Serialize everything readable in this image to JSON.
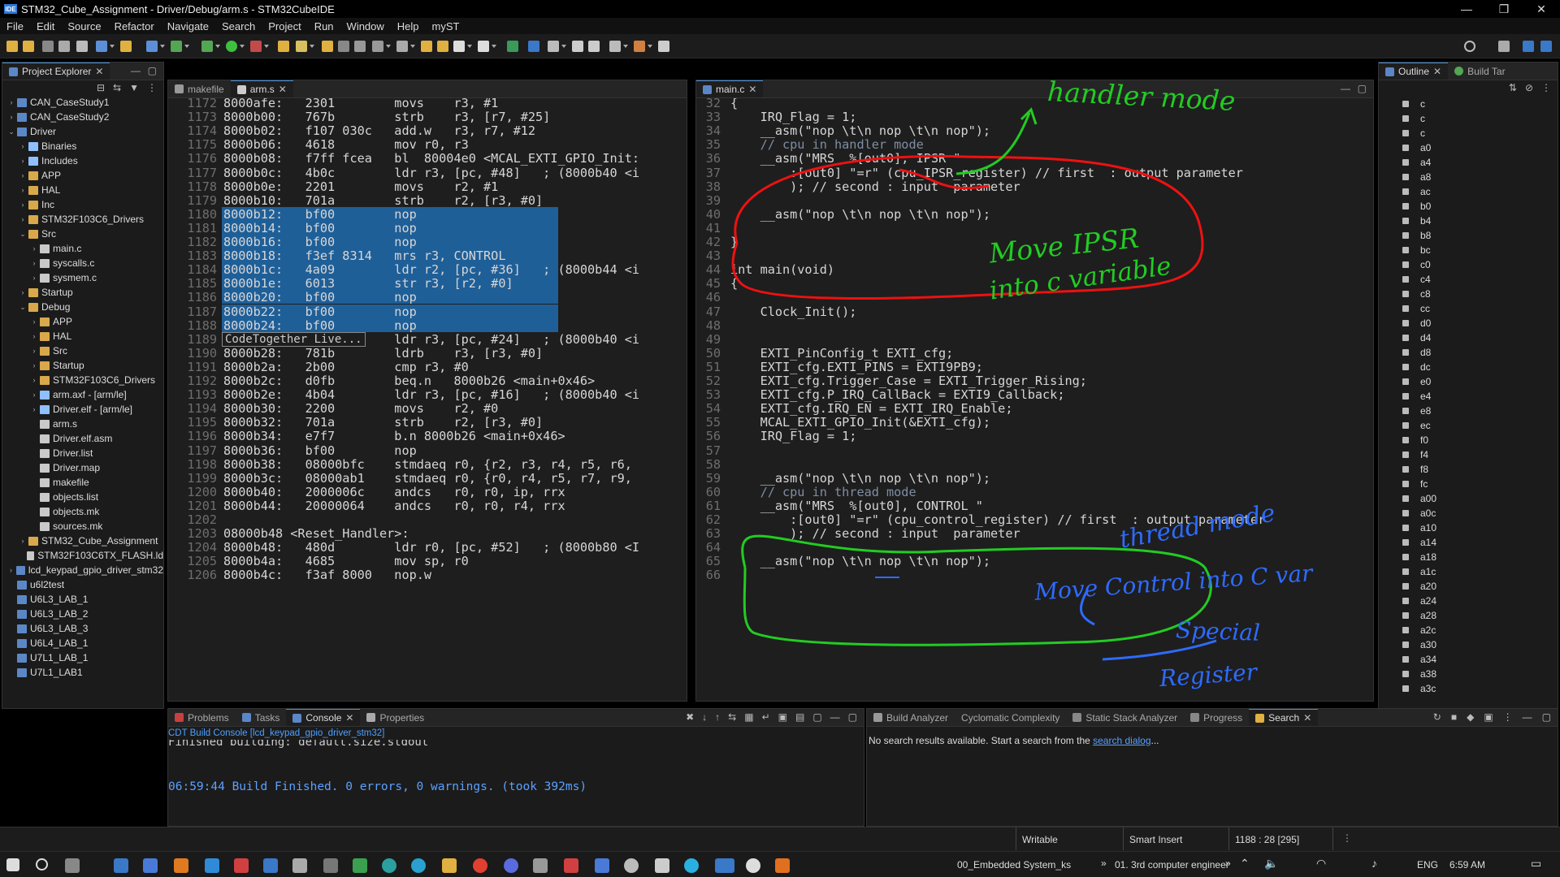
{
  "window": {
    "title": "STM32_Cube_Assignment - Driver/Debug/arm.s - STM32CubeIDE",
    "app_badge": "IDE",
    "controls": [
      "—",
      "❐",
      "✕"
    ]
  },
  "menu": [
    "File",
    "Edit",
    "Source",
    "Refactor",
    "Navigate",
    "Search",
    "Project",
    "Run",
    "Window",
    "Help",
    "myST"
  ],
  "explorer": {
    "title": "Project Explorer",
    "items": [
      {
        "label": "CAN_CaseStudy1",
        "indent": 0,
        "arrow": "›",
        "icon": "proj"
      },
      {
        "label": "CAN_CaseStudy2",
        "indent": 0,
        "arrow": "›",
        "icon": "proj"
      },
      {
        "label": "Driver",
        "indent": 0,
        "arrow": "⌄",
        "icon": "proj"
      },
      {
        "label": "Binaries",
        "indent": 1,
        "arrow": "›",
        "icon": "bin"
      },
      {
        "label": "Includes",
        "indent": 1,
        "arrow": "›",
        "icon": "bin"
      },
      {
        "label": "APP",
        "indent": 1,
        "arrow": "›",
        "icon": "folder"
      },
      {
        "label": "HAL",
        "indent": 1,
        "arrow": "›",
        "icon": "folder"
      },
      {
        "label": "Inc",
        "indent": 1,
        "arrow": "›",
        "icon": "folder"
      },
      {
        "label": "STM32F103C6_Drivers",
        "indent": 1,
        "arrow": "›",
        "icon": "folder"
      },
      {
        "label": "Src",
        "indent": 1,
        "arrow": "⌄",
        "icon": "folder"
      },
      {
        "label": "main.c",
        "indent": 2,
        "arrow": "›",
        "icon": "file"
      },
      {
        "label": "syscalls.c",
        "indent": 2,
        "arrow": "›",
        "icon": "file"
      },
      {
        "label": "sysmem.c",
        "indent": 2,
        "arrow": "›",
        "icon": "file"
      },
      {
        "label": "Startup",
        "indent": 1,
        "arrow": "›",
        "icon": "folder"
      },
      {
        "label": "Debug",
        "indent": 1,
        "arrow": "⌄",
        "icon": "folder"
      },
      {
        "label": "APP",
        "indent": 2,
        "arrow": "›",
        "icon": "folder"
      },
      {
        "label": "HAL",
        "indent": 2,
        "arrow": "›",
        "icon": "folder"
      },
      {
        "label": "Src",
        "indent": 2,
        "arrow": "›",
        "icon": "folder"
      },
      {
        "label": "Startup",
        "indent": 2,
        "arrow": "›",
        "icon": "folder"
      },
      {
        "label": "STM32F103C6_Drivers",
        "indent": 2,
        "arrow": "›",
        "icon": "folder"
      },
      {
        "label": "arm.axf - [arm/le]",
        "indent": 2,
        "arrow": "›",
        "icon": "bin"
      },
      {
        "label": "Driver.elf - [arm/le]",
        "indent": 2,
        "arrow": "›",
        "icon": "bin"
      },
      {
        "label": "arm.s",
        "indent": 2,
        "arrow": "",
        "icon": "file"
      },
      {
        "label": "Driver.elf.asm",
        "indent": 2,
        "arrow": "",
        "icon": "file"
      },
      {
        "label": "Driver.list",
        "indent": 2,
        "arrow": "",
        "icon": "file"
      },
      {
        "label": "Driver.map",
        "indent": 2,
        "arrow": "",
        "icon": "file"
      },
      {
        "label": "makefile",
        "indent": 2,
        "arrow": "",
        "icon": "file"
      },
      {
        "label": "objects.list",
        "indent": 2,
        "arrow": "",
        "icon": "file"
      },
      {
        "label": "objects.mk",
        "indent": 2,
        "arrow": "",
        "icon": "file"
      },
      {
        "label": "sources.mk",
        "indent": 2,
        "arrow": "",
        "icon": "file"
      },
      {
        "label": "STM32_Cube_Assignment",
        "indent": 1,
        "arrow": "›",
        "icon": "folder"
      },
      {
        "label": "STM32F103C6TX_FLASH.ld",
        "indent": 1,
        "arrow": "",
        "icon": "file"
      },
      {
        "label": "lcd_keypad_gpio_driver_stm32",
        "indent": 0,
        "arrow": "›",
        "icon": "proj"
      },
      {
        "label": "u6l2test",
        "indent": 0,
        "arrow": "",
        "icon": "proj"
      },
      {
        "label": "U6L3_LAB_1",
        "indent": 0,
        "arrow": "",
        "icon": "proj"
      },
      {
        "label": "U6L3_LAB_2",
        "indent": 0,
        "arrow": "",
        "icon": "proj"
      },
      {
        "label": "U6L3_LAB_3",
        "indent": 0,
        "arrow": "",
        "icon": "proj"
      },
      {
        "label": "U6L4_LAB_1",
        "indent": 0,
        "arrow": "",
        "icon": "proj"
      },
      {
        "label": "U7L1_LAB_1",
        "indent": 0,
        "arrow": "",
        "icon": "proj"
      },
      {
        "label": "U7L1_LAB1",
        "indent": 0,
        "arrow": "",
        "icon": "proj"
      }
    ]
  },
  "editor_left": {
    "tabs": [
      "makefile",
      "arm.s"
    ],
    "lines": [
      {
        "n": "1172",
        "t": "8000afe:   2301        movs    r3, #1"
      },
      {
        "n": "1173",
        "t": "8000b00:   767b        strb    r3, [r7, #25]"
      },
      {
        "n": "1174",
        "t": "8000b02:   f107 030c   add.w   r3, r7, #12"
      },
      {
        "n": "1175",
        "t": "8000b06:   4618        mov r0, r3"
      },
      {
        "n": "1176",
        "t": "8000b08:   f7ff fcea   bl  80004e0 <MCAL_EXTI_GPIO_Init:"
      },
      {
        "n": "1177",
        "t": "8000b0c:   4b0c        ldr r3, [pc, #48]   ; (8000b40 <i"
      },
      {
        "n": "1178",
        "t": "8000b0e:   2201        movs    r2, #1"
      },
      {
        "n": "1179",
        "t": "8000b10:   701a        strb    r2, [r3, #0]"
      },
      {
        "n": "1180",
        "t": "8000b12:   bf00        nop"
      },
      {
        "n": "1181",
        "t": "8000b14:   bf00        nop"
      },
      {
        "n": "1182",
        "t": "8000b16:   bf00        nop"
      },
      {
        "n": "1183",
        "t": "8000b18:   f3ef 8314   mrs r3, CONTROL"
      },
      {
        "n": "1184",
        "t": "8000b1c:   4a09        ldr r2, [pc, #36]   ; (8000b44 <i"
      },
      {
        "n": "1185",
        "t": "8000b1e:   6013        str r3, [r2, #0]"
      },
      {
        "n": "1186",
        "t": "8000b20:   bf00        nop"
      },
      {
        "n": "1187",
        "t": "8000b22:   bf00        nop"
      },
      {
        "n": "1188",
        "t": "8000b24:   bf00        nop"
      },
      {
        "n": "1189",
        "t": "                       ldr r3, [pc, #24]   ; (8000b40 <i"
      },
      {
        "n": "1190",
        "t": "8000b28:   781b        ldrb    r3, [r3, #0]"
      },
      {
        "n": "1191",
        "t": "8000b2a:   2b00        cmp r3, #0"
      },
      {
        "n": "1192",
        "t": "8000b2c:   d0fb        beq.n   8000b26 <main+0x46>"
      },
      {
        "n": "1193",
        "t": "8000b2e:   4b04        ldr r3, [pc, #16]   ; (8000b40 <i"
      },
      {
        "n": "1194",
        "t": "8000b30:   2200        movs    r2, #0"
      },
      {
        "n": "1195",
        "t": "8000b32:   701a        strb    r2, [r3, #0]"
      },
      {
        "n": "1196",
        "t": "8000b34:   e7f7        b.n 8000b26 <main+0x46>"
      },
      {
        "n": "1197",
        "t": "8000b36:   bf00        nop"
      },
      {
        "n": "1198",
        "t": "8000b38:   08000bfc    stmdaeq r0, {r2, r3, r4, r5, r6,"
      },
      {
        "n": "1199",
        "t": "8000b3c:   08000ab1    stmdaeq r0, {r0, r4, r5, r7, r9,"
      },
      {
        "n": "1200",
        "t": "8000b40:   2000006c    andcs   r0, r0, ip, rrx"
      },
      {
        "n": "1201",
        "t": "8000b44:   20000064    andcs   r0, r0, r4, rrx"
      },
      {
        "n": "1202",
        "t": ""
      },
      {
        "n": "1203",
        "t": "08000b48 <Reset_Handler>:"
      },
      {
        "n": "1204",
        "t": "8000b48:   480d        ldr r0, [pc, #52]   ; (8000b80 <I"
      },
      {
        "n": "1205",
        "t": "8000b4a:   4685        mov sp, r0"
      },
      {
        "n": "1206",
        "t": "8000b4c:   f3af 8000   nop.w"
      }
    ],
    "tooltip": "CodeTogether Live..."
  },
  "editor_right": {
    "tabs": [
      "main.c"
    ],
    "lines": [
      {
        "n": "32",
        "t": "{"
      },
      {
        "n": "33",
        "t": "    IRQ_Flag = 1;"
      },
      {
        "n": "34",
        "t": "    __asm(\"nop \\t\\n nop \\t\\n nop\");"
      },
      {
        "n": "35",
        "t": "    // cpu in handler mode"
      },
      {
        "n": "36",
        "t": "    __asm(\"MRS  %[out0], IPSR \""
      },
      {
        "n": "37",
        "t": "        :[out0] \"=r\" (cpu_IPSR_register) // first  : output parameter"
      },
      {
        "n": "38",
        "t": "        ); // second : input  parameter"
      },
      {
        "n": "39",
        "t": ""
      },
      {
        "n": "40",
        "t": "    __asm(\"nop \\t\\n nop \\t\\n nop\");"
      },
      {
        "n": "41",
        "t": ""
      },
      {
        "n": "42",
        "t": "}"
      },
      {
        "n": "43",
        "t": ""
      },
      {
        "n": "44",
        "t": "int main(void)"
      },
      {
        "n": "45",
        "t": "{"
      },
      {
        "n": "46",
        "t": ""
      },
      {
        "n": "47",
        "t": "    Clock_Init();"
      },
      {
        "n": "48",
        "t": ""
      },
      {
        "n": "49",
        "t": ""
      },
      {
        "n": "50",
        "t": "    EXTI_PinConfig_t EXTI_cfg;"
      },
      {
        "n": "51",
        "t": "    EXTI_cfg.EXTI_PINS = EXTI9PB9;"
      },
      {
        "n": "52",
        "t": "    EXTI_cfg.Trigger_Case = EXTI_Trigger_Rising;"
      },
      {
        "n": "53",
        "t": "    EXTI_cfg.P_IRQ_CallBack = EXTI9_Callback;"
      },
      {
        "n": "54",
        "t": "    EXTI_cfg.IRQ_EN = EXTI_IRQ_Enable;"
      },
      {
        "n": "55",
        "t": "    MCAL_EXTI_GPIO_Init(&EXTI_cfg);"
      },
      {
        "n": "56",
        "t": "    IRQ_Flag = 1;"
      },
      {
        "n": "57",
        "t": ""
      },
      {
        "n": "58",
        "t": ""
      },
      {
        "n": "59",
        "t": "    __asm(\"nop \\t\\n nop \\t\\n nop\");"
      },
      {
        "n": "60",
        "t": "    // cpu in thread mode"
      },
      {
        "n": "61",
        "t": "    __asm(\"MRS  %[out0], CONTROL \""
      },
      {
        "n": "62",
        "t": "        :[out0] \"=r\" (cpu_control_register) // first  : output parameter"
      },
      {
        "n": "63",
        "t": "        ); // second : input  parameter"
      },
      {
        "n": "64",
        "t": ""
      },
      {
        "n": "65",
        "t": "    __asm(\"nop \\t\\n nop \\t\\n nop\");"
      },
      {
        "n": "66",
        "t": ""
      }
    ],
    "annotations": {
      "handler": "handler mode",
      "ipsr1": "Move IPSR",
      "ipsr2": "into c variable",
      "thread": "thread mode",
      "ctrl1": "Move Control into C var",
      "ctrl2": "Special",
      "ctrl3": "Register"
    }
  },
  "outline": {
    "tabs": [
      "Outline",
      "Build Tar"
    ],
    "items": [
      "c",
      "c",
      "c",
      "a0",
      "a4",
      "a8",
      "ac",
      "b0",
      "b4",
      "b8",
      "bc",
      "c0",
      "c4",
      "c8",
      "cc",
      "d0",
      "d4",
      "d8",
      "dc",
      "e0",
      "e4",
      "e8",
      "ec",
      "f0",
      "f4",
      "f8",
      "fc",
      "a00",
      "a0c",
      "a10",
      "a14",
      "a18",
      "a1c",
      "a20",
      "a24",
      "a28",
      "a2c",
      "a30",
      "a34",
      "a38",
      "a3c"
    ]
  },
  "console": {
    "tabs": [
      "Problems",
      "Tasks",
      "Console",
      "Properties"
    ],
    "header": "CDT Build Console [lcd_keypad_gpio_driver_stm32]",
    "line_cut": "Finished building: default.size.stdout",
    "line": "06:59:44 Build Finished. 0 errors, 0 warnings. (took 392ms)"
  },
  "search_panel": {
    "tabs": [
      "Build Analyzer",
      "Cyclomatic Complexity",
      "Static Stack Analyzer",
      "Progress",
      "Search"
    ],
    "message": "No search results available. Start a search from the ",
    "link": "search dialog",
    "ellipsis": "..."
  },
  "status": {
    "mode": "Writable",
    "insert": "Smart Insert",
    "position": "1188 : 28 [295]"
  },
  "taskbar": {
    "task1": "00_Embedded System_ks",
    "task2": "01. 3rd computer engineer",
    "lang": "ENG",
    "time": "6:59 AM"
  },
  "colors": {
    "selection": "#1f5f98",
    "annotation_green": "#22cc22",
    "annotation_red": "#ee1111",
    "annotation_blue": "#2e6bff"
  }
}
